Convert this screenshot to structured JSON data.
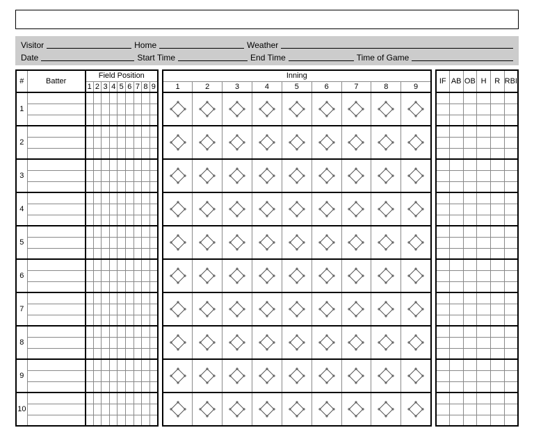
{
  "info": {
    "visitor_label": "Visitor",
    "home_label": "Home",
    "weather_label": "Weather",
    "date_label": "Date",
    "start_time_label": "Start Time",
    "end_time_label": "End Time",
    "time_of_game_label": "Time of Game"
  },
  "headers": {
    "num": "#",
    "batter": "Batter",
    "field_position": "Field Position",
    "inning": "Inning",
    "fp": [
      "1",
      "2",
      "3",
      "4",
      "5",
      "6",
      "7",
      "8",
      "9"
    ],
    "in": [
      "1",
      "2",
      "3",
      "4",
      "5",
      "6",
      "7",
      "8",
      "9"
    ],
    "stats": [
      "IF",
      "AB",
      "OB",
      "H",
      "R",
      "RBI"
    ]
  },
  "rows": [
    "1",
    "2",
    "3",
    "4",
    "5",
    "6",
    "7",
    "8",
    "9",
    "10"
  ]
}
